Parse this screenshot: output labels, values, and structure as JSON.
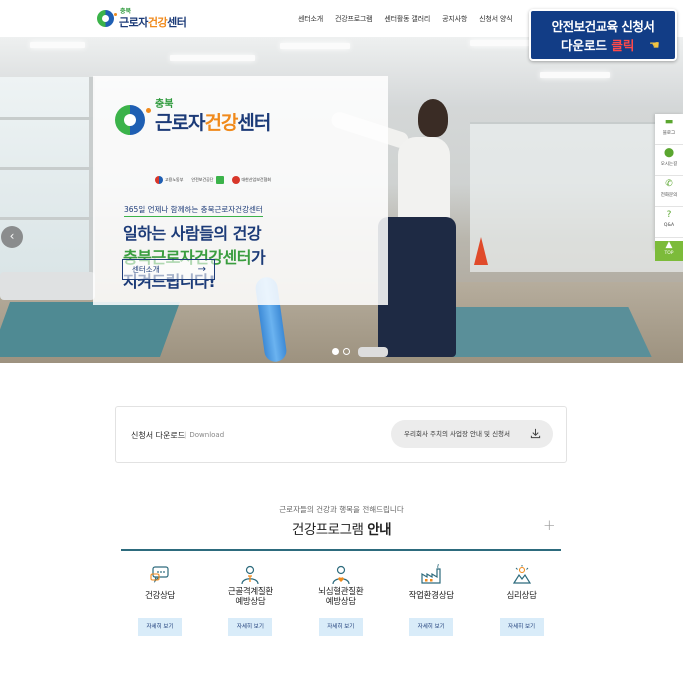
{
  "header": {
    "logo_small": "충북",
    "logo_main_a": "근로자",
    "logo_main_b": "건강",
    "logo_main_c": "센터",
    "nav": [
      "센터소개",
      "건강프로그램",
      "센터활동 갤러리",
      "공지사항",
      "신청서 양식"
    ]
  },
  "promo": {
    "line1": "안전보건교육 신청서",
    "line2_a": "다운로드",
    "line2_b": "클릭"
  },
  "hero": {
    "panel_logo_small": "충북",
    "panel_logo_a": "근로자",
    "panel_logo_b": "건강",
    "panel_logo_c": "센터",
    "partners": [
      "고용노동부",
      "안전보건공단",
      "대한산업보건협회"
    ],
    "tagline": "365일 언제나 함께하는 충북근로자건강센터",
    "headline_1": "일하는 사람들의 건강",
    "headline_2_green": "충북근로자건강센터",
    "headline_2_rest": "가",
    "headline_3": "지켜드립니다!",
    "cta_label": "센터소개",
    "cta_arrow": "→",
    "slides": 2,
    "active_slide": 1
  },
  "quick_menu": [
    {
      "icon": "chat-icon",
      "label": "블로그"
    },
    {
      "icon": "location-icon",
      "label": "오시는길"
    },
    {
      "icon": "phone-icon",
      "label": "전화문의"
    },
    {
      "icon": "question-icon",
      "label": "Q&A"
    },
    {
      "icon": "arrow-up-icon",
      "label": "TOP"
    }
  ],
  "download": {
    "title": "신청서 다운로드",
    "subtitle": "Download",
    "button_label": "우리회사 주치의 사업장 안내 및 신청서"
  },
  "programs": {
    "subtitle": "근로자들의 건강과 행복을 전해드립니다",
    "title_a": "건강프로그램",
    "title_b": "안내",
    "items": [
      {
        "icon": "chat-bubbles-icon",
        "label": "건강상담",
        "button": "자세히 보기"
      },
      {
        "icon": "person-bone-icon",
        "label": "근골격계질환 예방상담",
        "button": "자세히 보기"
      },
      {
        "icon": "person-heart-icon",
        "label": "뇌심혈관질환 예방상담",
        "button": "자세히 보기"
      },
      {
        "icon": "factory-icon",
        "label": "작업환경상담",
        "button": "자세히 보기"
      },
      {
        "icon": "mind-icon",
        "label": "심리상담",
        "button": "자세히 보기"
      }
    ]
  },
  "colors": {
    "brand_navy": "#1c3b78",
    "brand_green": "#3a9d3f",
    "brand_orange": "#f08a1c",
    "section_line": "#2d6b7d",
    "promo_bg": "#123d86"
  }
}
